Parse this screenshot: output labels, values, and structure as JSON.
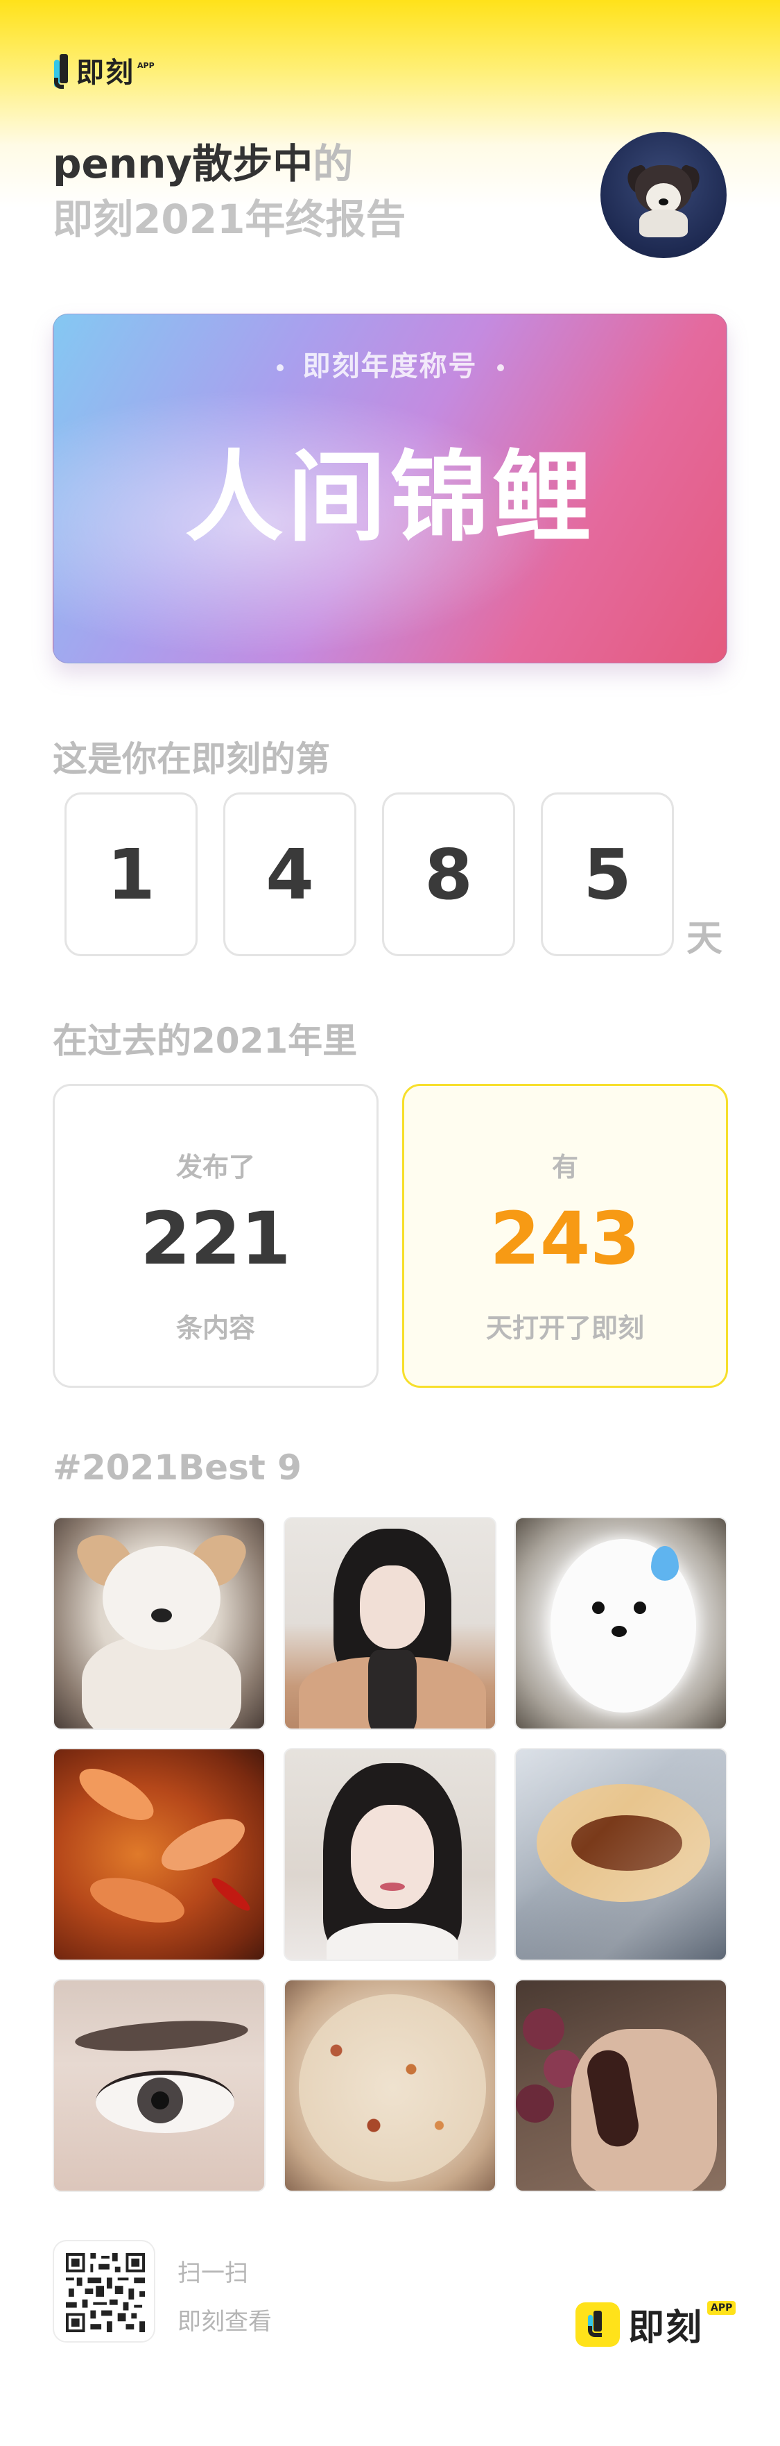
{
  "brand": {
    "name": "即刻",
    "app_badge": "APP"
  },
  "header": {
    "username": "penny散步中",
    "username_suffix": "的",
    "report_title": "即刻2021年终报告"
  },
  "title_card": {
    "label": "即刻年度称号",
    "title": "人间锦鲤",
    "gradient_colors": [
      "#84c8f2",
      "#a9a0ee",
      "#c48be0",
      "#e46a9e"
    ]
  },
  "days_section": {
    "heading": "这是你在即刻的第",
    "digits": [
      "1",
      "4",
      "8",
      "5"
    ],
    "unit": "天"
  },
  "year_section": {
    "heading": "在过去的2021年里",
    "posts": {
      "top": "发布了",
      "value": "221",
      "bottom": "条内容"
    },
    "opens": {
      "top": "有",
      "value": "243",
      "bottom": "天打开了即刻",
      "accent_color": "#f79a14"
    }
  },
  "best9": {
    "heading": "#2021Best 9",
    "photos": [
      {
        "icon": "puppy-photo"
      },
      {
        "icon": "portrait-photo"
      },
      {
        "icon": "white-dog-photo"
      },
      {
        "icon": "crayfish-photo"
      },
      {
        "icon": "selfie-photo"
      },
      {
        "icon": "roujiamo-photo"
      },
      {
        "icon": "eye-closeup-photo"
      },
      {
        "icon": "fried-rice-photo"
      },
      {
        "icon": "grapes-hand-photo"
      }
    ]
  },
  "footer": {
    "scan_text": "扫一扫",
    "view_text": "即刻查看",
    "brand_name": "即刻",
    "brand_app": "APP",
    "brand_color": "#ffe21a"
  }
}
